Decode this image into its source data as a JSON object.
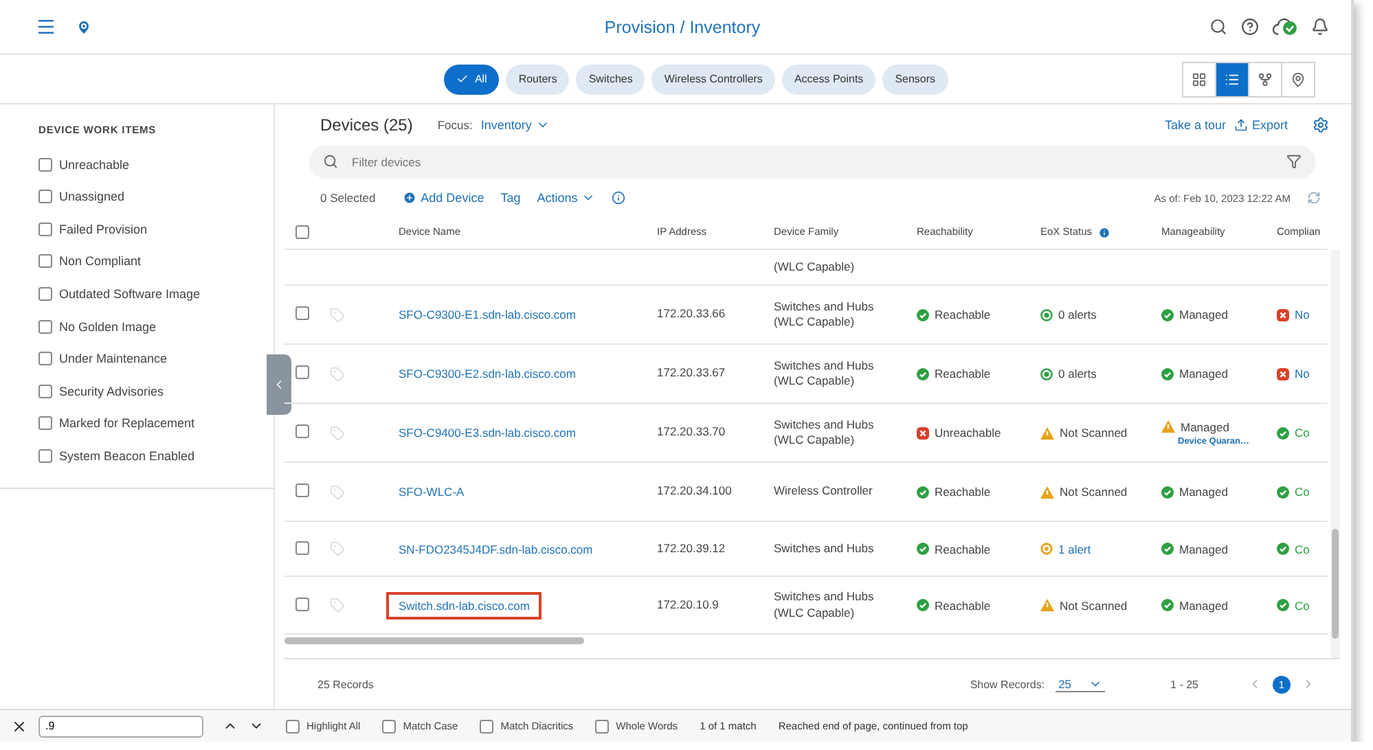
{
  "header": {
    "title": "Provision / Inventory"
  },
  "chips": [
    {
      "label": "All",
      "selected": true
    },
    {
      "label": "Routers",
      "selected": false
    },
    {
      "label": "Switches",
      "selected": false
    },
    {
      "label": "Wireless Controllers",
      "selected": false
    },
    {
      "label": "Access Points",
      "selected": false
    },
    {
      "label": "Sensors",
      "selected": false
    }
  ],
  "view_modes": [
    {
      "kind": "grid",
      "selected": false
    },
    {
      "kind": "list",
      "selected": true
    },
    {
      "kind": "topology",
      "selected": false
    },
    {
      "kind": "map",
      "selected": false
    }
  ],
  "sidebar": {
    "title": "DEVICE WORK ITEMS",
    "items": [
      {
        "label": "Unreachable",
        "checked": false
      },
      {
        "label": "Unassigned",
        "checked": false
      },
      {
        "label": "Failed Provision",
        "checked": false
      },
      {
        "label": "Non Compliant",
        "checked": false
      },
      {
        "label": "Outdated Software Image",
        "checked": false
      },
      {
        "label": "No Golden Image",
        "checked": false
      },
      {
        "label": "Under Maintenance",
        "checked": false
      },
      {
        "label": "Security Advisories",
        "checked": false
      },
      {
        "label": "Marked for Replacement",
        "checked": false
      },
      {
        "label": "System Beacon Enabled",
        "checked": false
      }
    ]
  },
  "devices": {
    "title": "Devices (25)",
    "focus_label": "Focus:",
    "focus_value": "Inventory",
    "take_tour": "Take a tour",
    "export": "Export",
    "search": {
      "placeholder": "Filter devices"
    },
    "selected_count": "0 Selected",
    "add_device": "Add Device",
    "tag": "Tag",
    "actions": "Actions",
    "as_of": "As of: Feb 10, 2023 12:22 AM"
  },
  "table": {
    "columns": [
      "Device Name",
      "IP Address",
      "Device Family",
      "Reachability",
      "EoX Status",
      "Manageability",
      "Complian"
    ],
    "select_all_checked": false,
    "partial_row": {
      "family": "(WLC Capable)"
    },
    "rows": [
      {
        "checked": false,
        "highlighted": false,
        "name": "SFO-C9300-E1.sdn-lab.cisco.com",
        "ip": "172.20.33.66",
        "family": "Switches and Hubs (WLC Capable)",
        "reachability": {
          "text": "Reachable",
          "kind": "ok"
        },
        "eox": {
          "text": "0 alerts",
          "kind": "ok"
        },
        "manageability": {
          "text": "Managed",
          "kind": "ok"
        },
        "compliance": {
          "text": "No",
          "kind": "error"
        }
      },
      {
        "checked": false,
        "highlighted": false,
        "name": "SFO-C9300-E2.sdn-lab.cisco.com",
        "ip": "172.20.33.67",
        "family": "Switches and Hubs (WLC Capable)",
        "reachability": {
          "text": "Reachable",
          "kind": "ok"
        },
        "eox": {
          "text": "0 alerts",
          "kind": "ok"
        },
        "manageability": {
          "text": "Managed",
          "kind": "ok"
        },
        "compliance": {
          "text": "No",
          "kind": "error"
        }
      },
      {
        "checked": false,
        "highlighted": false,
        "name": "SFO-C9400-E3.sdn-lab.cisco.com",
        "ip": "172.20.33.70",
        "family": "Switches and Hubs (WLC Capable)",
        "reachability": {
          "text": "Unreachable",
          "kind": "error"
        },
        "eox": {
          "text": "Not Scanned",
          "kind": "warning"
        },
        "manageability": {
          "text": "Managed",
          "kind": "warning",
          "note": "Device Quaran…"
        },
        "compliance": {
          "text": "Co",
          "kind": "ok"
        }
      },
      {
        "checked": false,
        "highlighted": false,
        "name": "SFO-WLC-A",
        "ip": "172.20.34.100",
        "family": "Wireless Controller",
        "reachability": {
          "text": "Reachable",
          "kind": "ok"
        },
        "eox": {
          "text": "Not Scanned",
          "kind": "warning"
        },
        "manageability": {
          "text": "Managed",
          "kind": "ok"
        },
        "compliance": {
          "text": "Co",
          "kind": "ok"
        }
      },
      {
        "checked": false,
        "highlighted": false,
        "name": "SN-FDO2345J4DF.sdn-lab.cisco.com",
        "ip": "172.20.39.12",
        "family": "Switches and Hubs",
        "reachability": {
          "text": "Reachable",
          "kind": "ok"
        },
        "eox": {
          "text": "1 alert",
          "kind": "alert"
        },
        "manageability": {
          "text": "Managed",
          "kind": "ok"
        },
        "compliance": {
          "text": "Co",
          "kind": "ok"
        }
      },
      {
        "checked": false,
        "highlighted": true,
        "name": "Switch.sdn-lab.cisco.com",
        "ip": "172.20.10.9",
        "family": "Switches and Hubs (WLC Capable)",
        "reachability": {
          "text": "Reachable",
          "kind": "ok"
        },
        "eox": {
          "text": "Not Scanned",
          "kind": "warning"
        },
        "manageability": {
          "text": "Managed",
          "kind": "ok"
        },
        "compliance": {
          "text": "Co",
          "kind": "ok"
        }
      }
    ]
  },
  "footer": {
    "records": "25 Records",
    "show_label": "Show Records:",
    "show_value": "25",
    "range": "1 - 25",
    "pages": [
      {
        "label": "1",
        "selected": true
      }
    ]
  },
  "find_bar": {
    "value": ".9",
    "options": [
      {
        "label": "Highlight All",
        "checked": false
      },
      {
        "label": "Match Case",
        "checked": false
      },
      {
        "label": "Match Diacritics",
        "checked": false
      },
      {
        "label": "Whole Words",
        "checked": false
      }
    ],
    "result": "1 of 1 match",
    "message": "Reached end of page, continued from top"
  }
}
